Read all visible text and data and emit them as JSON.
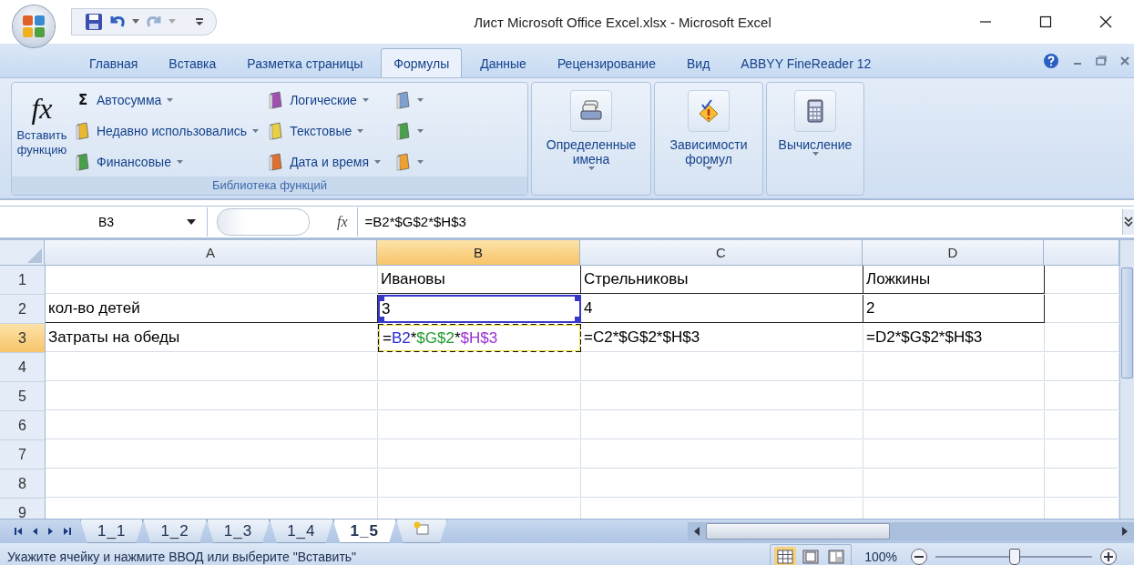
{
  "window": {
    "title": "Лист Microsoft Office Excel.xlsx - Microsoft Excel"
  },
  "ribbon_tabs": [
    {
      "label": "Главная",
      "selected": false
    },
    {
      "label": "Вставка",
      "selected": false
    },
    {
      "label": "Разметка страницы",
      "selected": false
    },
    {
      "label": "Формулы",
      "selected": true
    },
    {
      "label": "Данные",
      "selected": false
    },
    {
      "label": "Рецензирование",
      "selected": false
    },
    {
      "label": "Вид",
      "selected": false
    },
    {
      "label": "ABBYY FineReader 12",
      "selected": false
    }
  ],
  "function_library": {
    "label": "Библиотека функций",
    "insert_function": {
      "glyph": "fx",
      "lines": [
        "Вставить",
        "функцию"
      ]
    },
    "items": [
      [
        {
          "glyph": "Σ",
          "label": "Автосумма"
        },
        {
          "label": "Недавно использовались"
        },
        {
          "label": "Финансовые"
        }
      ],
      [
        {
          "label": "Логические"
        },
        {
          "label": "Текстовые"
        },
        {
          "label": "Дата и время"
        }
      ]
    ]
  },
  "big_buttons": [
    {
      "lines": [
        "Определенные",
        "имена"
      ]
    },
    {
      "lines": [
        "Зависимости",
        "формул"
      ]
    },
    {
      "lines": [
        "Вычисление"
      ]
    }
  ],
  "formula_bar": {
    "name_box": "B3",
    "fx": "fx",
    "formula": "=B2*$G$2*$H$3"
  },
  "columns": [
    {
      "label": "A",
      "selected": false
    },
    {
      "label": "B",
      "selected": true
    },
    {
      "label": "C",
      "selected": false
    },
    {
      "label": "D",
      "selected": false
    }
  ],
  "rows": [
    {
      "header": "1",
      "selected": false,
      "cells": [
        null,
        {
          "kind": "text",
          "text": "Ивановы"
        },
        {
          "kind": "text",
          "text": "Стрельниковы"
        },
        {
          "kind": "text",
          "text": "Ложкины"
        }
      ]
    },
    {
      "header": "2",
      "selected": false,
      "cells": [
        {
          "kind": "text",
          "text": "кол-во детей"
        },
        {
          "kind": "referenced",
          "text": "3"
        },
        {
          "kind": "text",
          "text": "4"
        },
        {
          "kind": "text",
          "text": "2"
        }
      ]
    },
    {
      "header": "3",
      "selected": true,
      "cells": [
        {
          "kind": "text",
          "text": "Затраты на обеды"
        },
        {
          "kind": "editing",
          "parts": [
            {
              "text": "="
            },
            {
              "text": "B2",
              "color": "#2b2bd0"
            },
            {
              "text": "*"
            },
            {
              "text": "$G$2",
              "color": "#1f9a2a"
            },
            {
              "text": "*"
            },
            {
              "text": "$H$3",
              "color": "#9a2fd0"
            }
          ]
        },
        {
          "kind": "text",
          "text": "=C2*$G$2*$H$3"
        },
        {
          "kind": "text",
          "text": "=D2*$G$2*$H$3"
        }
      ]
    },
    {
      "header": "4",
      "selected": false
    },
    {
      "header": "5",
      "selected": false
    },
    {
      "header": "6",
      "selected": false
    },
    {
      "header": "7",
      "selected": false
    },
    {
      "header": "8",
      "selected": false
    },
    {
      "header": "9",
      "selected": false
    }
  ],
  "sheet_tabs": [
    {
      "label": "1_1",
      "selected": false
    },
    {
      "label": "1_2",
      "selected": false
    },
    {
      "label": "1_3",
      "selected": false
    },
    {
      "label": "1_4",
      "selected": false
    },
    {
      "label": "1_5",
      "selected": true
    }
  ],
  "status_bar": {
    "message": "Укажите ячейку и нажмите ВВОД или выберите \"Вставить\"",
    "views": [
      {
        "selected": true
      },
      {
        "selected": false
      },
      {
        "selected": false
      }
    ],
    "zoom": "100%",
    "zoom_slider": {
      "level": 0.5
    }
  }
}
